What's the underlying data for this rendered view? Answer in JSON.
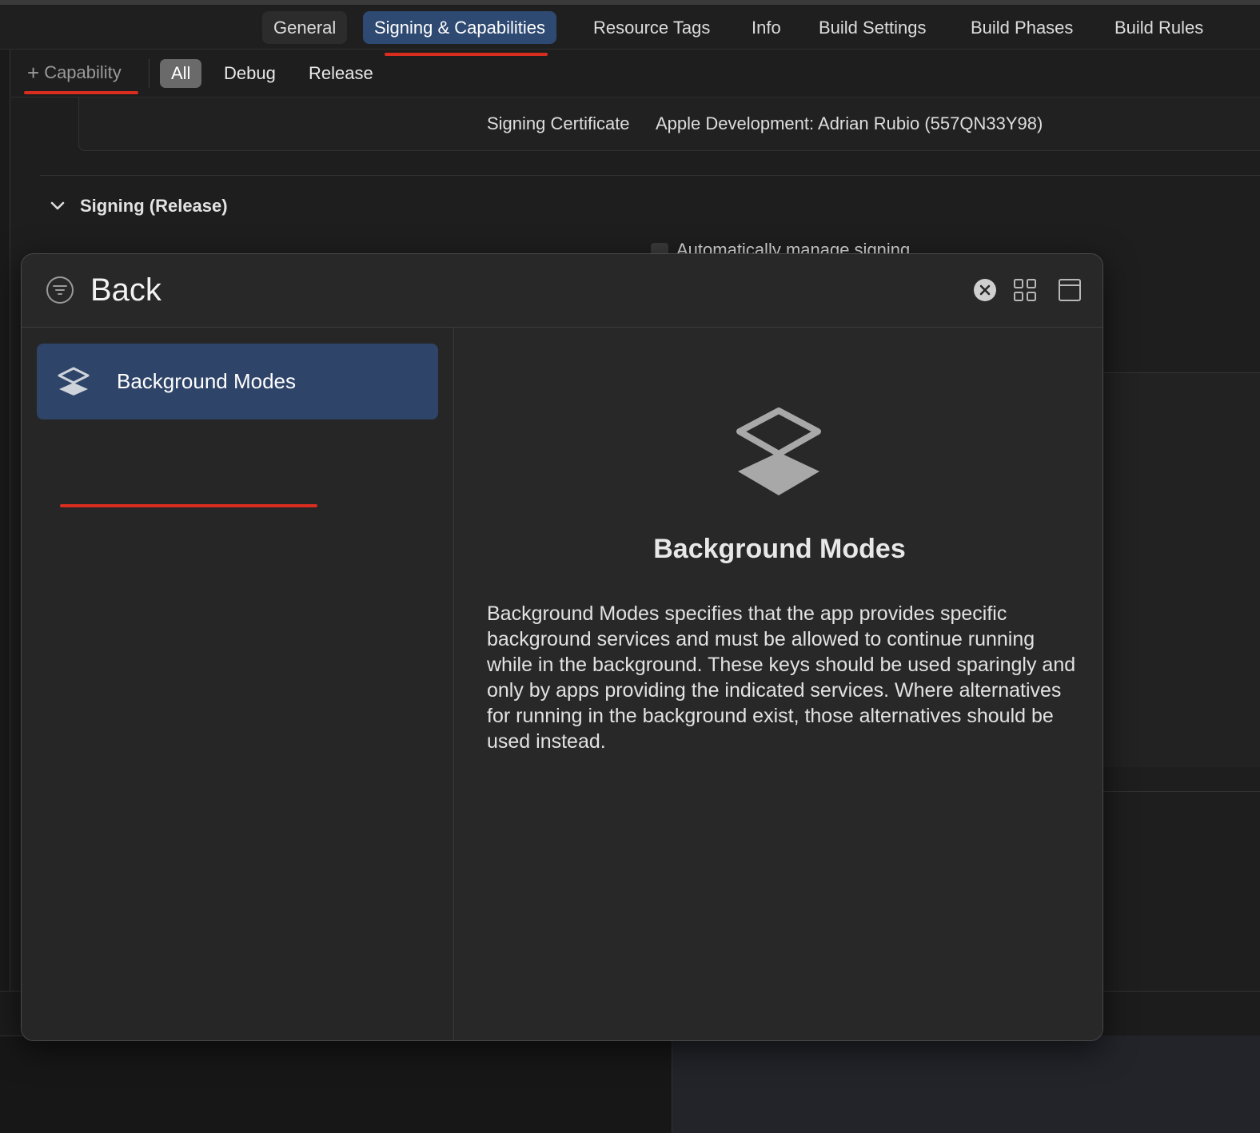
{
  "tabs": [
    {
      "label": "General"
    },
    {
      "label": "Signing & Capabilities"
    },
    {
      "label": "Resource Tags"
    },
    {
      "label": "Info"
    },
    {
      "label": "Build Settings"
    },
    {
      "label": "Build Phases"
    },
    {
      "label": "Build Rules"
    }
  ],
  "active_tab": "Signing & Capabilities",
  "filter_bar": {
    "add_capability": "Capability",
    "segments": [
      "All",
      "Debug",
      "Release"
    ],
    "selected_segment": "All"
  },
  "signing": {
    "certificate_label": "Signing Certificate",
    "certificate_value": "Apple Development: Adrian Rubio (557QN33Y98)",
    "section_title": "Signing (Release)",
    "auto_manage_label": "Automatically manage signing"
  },
  "popup": {
    "search_value": "Back",
    "results": [
      {
        "label": "Background Modes",
        "icon": "layers-icon",
        "selected": true
      }
    ],
    "detail": {
      "title": "Background Modes",
      "description": "Background Modes specifies that the app provides specific background services and must be allowed to continue running while in the background. These keys should be used sparingly and only by apps providing the indicated services. Where alternatives for running in the background exist, those alternatives should be used instead."
    }
  },
  "colors": {
    "accent_selected": "#2f4a72",
    "annotation_red": "#d92d20"
  }
}
